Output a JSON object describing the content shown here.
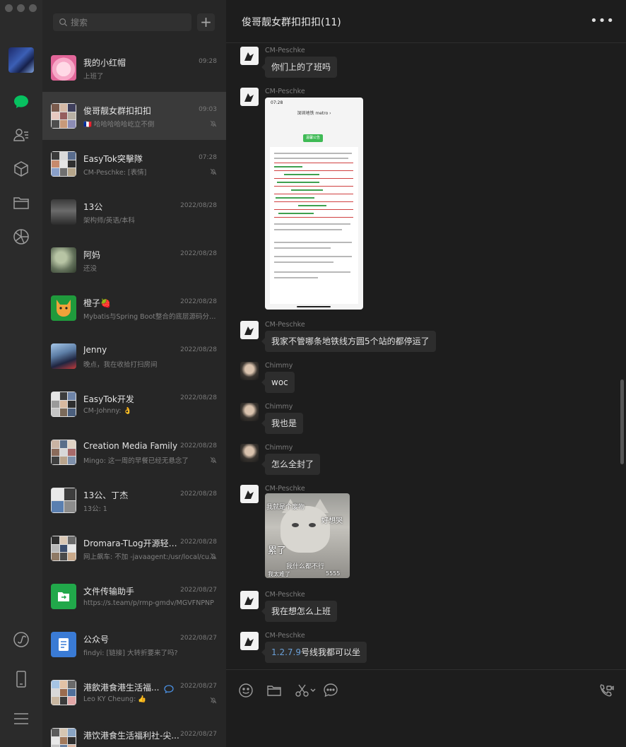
{
  "sidebar": {
    "icons": [
      "chat-icon",
      "contacts-icon",
      "collections-icon",
      "files-icon",
      "moments-icon",
      "mini-programs-icon",
      "phone-icon",
      "menu-icon"
    ]
  },
  "search": {
    "placeholder": "搜索",
    "add_label": "+"
  },
  "chats": [
    {
      "name": "我的小红帽",
      "time": "09:28",
      "preview": "上班了",
      "muted": false,
      "active": false
    },
    {
      "name": "俊哥靓女群扣扣扣",
      "time": "09:03",
      "preview": "🇫🇷 哈哈哈哈哈屹立不倒",
      "muted": true,
      "active": true
    },
    {
      "name": "EasyTok突擊隊",
      "time": "07:28",
      "preview": "CM-Peschke: [表情]",
      "muted": true,
      "active": false
    },
    {
      "name": "13公",
      "time": "2022/08/28",
      "preview": "架构师/英语/本科",
      "muted": false,
      "active": false
    },
    {
      "name": "阿妈",
      "time": "2022/08/28",
      "preview": "还没",
      "muted": false,
      "active": false
    },
    {
      "name": "橙子🍓",
      "time": "2022/08/28",
      "preview": "Mybatis与Spring Boot整合的底层源码分析...",
      "muted": false,
      "active": false
    },
    {
      "name": "Jenny",
      "time": "2022/08/28",
      "preview": "晚点，我在收拾打扫房间",
      "muted": false,
      "active": false
    },
    {
      "name": "EasyTok开发",
      "time": "2022/08/28",
      "preview": "CM-Johnny: 👌",
      "muted": false,
      "active": false
    },
    {
      "name": "Creation Media Family",
      "time": "2022/08/28",
      "preview": "Mingo: 这一周的早餐已经无悬念了",
      "muted": true,
      "active": false
    },
    {
      "name": "13公、丁杰",
      "time": "2022/08/28",
      "preview": "13公: 1",
      "muted": false,
      "active": false
    },
    {
      "name": "Dromara-TLog开源轻量...",
      "time": "2022/08/28",
      "preview": "网上飙车: 不加 -javaagent:/usr/local/cu...",
      "muted": true,
      "active": false
    },
    {
      "name": "文件传输助手",
      "time": "2022/08/27",
      "preview": "https://s.team/p/rmp-gmdv/MGVFNPNP",
      "muted": false,
      "active": false
    },
    {
      "name": "公众号",
      "time": "2022/08/27",
      "preview": "findyi: [链接] 大转折要来了吗?",
      "muted": false,
      "active": false
    },
    {
      "name": "港飲港食港生活福...",
      "time": "2022/08/27",
      "preview": "Leo KY Cheung: 👍",
      "muted": true,
      "active": false
    },
    {
      "name": "港饮港食生活福利社-尖...",
      "time": "2022/08/27",
      "preview": "",
      "muted": false,
      "active": false
    }
  ],
  "conversation": {
    "title": "俊哥靓女群扣扣扣(11)",
    "more_label": "•••",
    "messages": [
      {
        "sender": "CM-Peschke",
        "type": "text",
        "text": "你们上的了班吗"
      },
      {
        "sender": "CM-Peschke",
        "type": "image",
        "image": "metro-notice-screenshot"
      },
      {
        "sender": "CM-Peschke",
        "type": "text",
        "text": "我家不管哪条地铁线方圆5个站的都停运了"
      },
      {
        "sender": "Chimmy",
        "type": "text",
        "text": "woc"
      },
      {
        "sender": "Chimmy",
        "type": "text",
        "text": "我也是"
      },
      {
        "sender": "Chimmy",
        "type": "text",
        "text": "怎么全封了"
      },
      {
        "sender": "CM-Peschke",
        "type": "image",
        "image": "cat-meme"
      },
      {
        "sender": "CM-Peschke",
        "type": "text",
        "text": "我在想怎么上班"
      },
      {
        "sender": "CM-Peschke",
        "type": "text",
        "text_link": "1.2.7.9",
        "text": "号线我都可以坐"
      }
    ],
    "phone_shot": {
      "time": "07:28",
      "title": "深圳地铁 metro ›",
      "tag": "温馨公告"
    },
    "cat_meme": {
      "top": "我就是个废物",
      "right": "好想哭",
      "middle": "累了",
      "bottom": "我什么都不行",
      "corner": "我太难了",
      "sound": "5555"
    }
  },
  "input_bar": {
    "tools": [
      "emoji-icon",
      "folder-icon",
      "scissors-icon",
      "chat-history-icon",
      "video-call-icon"
    ]
  },
  "colors": {
    "rail_bg": "#2b2b2b",
    "list_bg": "#262626",
    "active_bg": "#3a3a3a",
    "conv_bg": "#1d1d1d",
    "bubble_bg": "#2d2d2d",
    "accent_green": "#07c160",
    "link_blue": "#6aa0d8"
  }
}
